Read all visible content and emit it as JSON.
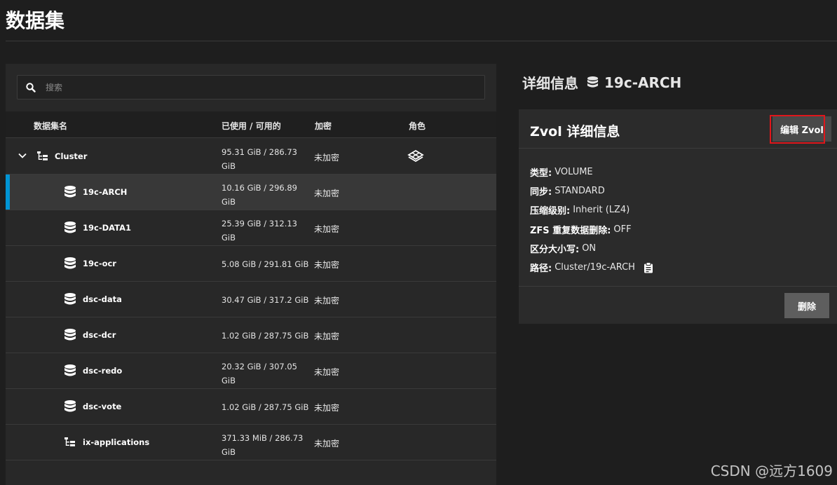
{
  "page": {
    "title": "数据集"
  },
  "search": {
    "placeholder": "搜索"
  },
  "table": {
    "headers": {
      "name": "数据集名",
      "used": "已使用 / 可用的",
      "encryption": "加密",
      "role": "角色"
    },
    "rows": [
      {
        "name": "Cluster",
        "used": "95.31 GiB / 286.73 GiB",
        "encryption": "未加密",
        "icon": "tree-icon",
        "role_icon": "share-roles-icon",
        "expanded": true
      },
      {
        "name": "19c-ARCH",
        "used": "10.16 GiB / 296.89 GiB",
        "encryption": "未加密",
        "icon": "database-icon",
        "selected": true
      },
      {
        "name": "19c-DATA1",
        "used": "25.39 GiB / 312.13 GiB",
        "encryption": "未加密",
        "icon": "database-icon"
      },
      {
        "name": "19c-ocr",
        "used": "5.08 GiB / 291.81 GiB",
        "encryption": "未加密",
        "icon": "database-icon"
      },
      {
        "name": "dsc-data",
        "used": "30.47 GiB / 317.2 GiB",
        "encryption": "未加密",
        "icon": "database-icon"
      },
      {
        "name": "dsc-dcr",
        "used": "1.02 GiB / 287.75 GiB",
        "encryption": "未加密",
        "icon": "database-icon"
      },
      {
        "name": "dsc-redo",
        "used": "20.32 GiB / 307.05 GiB",
        "encryption": "未加密",
        "icon": "database-icon"
      },
      {
        "name": "dsc-vote",
        "used": "1.02 GiB / 287.75 GiB",
        "encryption": "未加密",
        "icon": "database-icon"
      },
      {
        "name": "ix-applications",
        "used": "371.33 MiB / 286.73 GiB",
        "encryption": "未加密",
        "icon": "tree-icon"
      }
    ]
  },
  "details": {
    "heading": "详细信息",
    "dataset_name": "19c-ARCH",
    "card": {
      "title": "Zvol 详细信息",
      "edit_label": "编辑 Zvol",
      "delete_label": "删除",
      "properties": [
        {
          "key": "类型:",
          "value": "VOLUME"
        },
        {
          "key": "同步:",
          "value": "STANDARD"
        },
        {
          "key": "压缩级别:",
          "value": "Inherit (LZ4)"
        },
        {
          "key": "ZFS 重复数据删除:",
          "value": "OFF"
        },
        {
          "key": "区分大小写:",
          "value": "ON"
        },
        {
          "key": "路径:",
          "value": "Cluster/19c-ARCH"
        }
      ]
    }
  },
  "watermark": "CSDN @远方1609",
  "colors": {
    "accent": "#0095d5",
    "highlight": "#e0161b",
    "background": "#1e1e1e"
  }
}
